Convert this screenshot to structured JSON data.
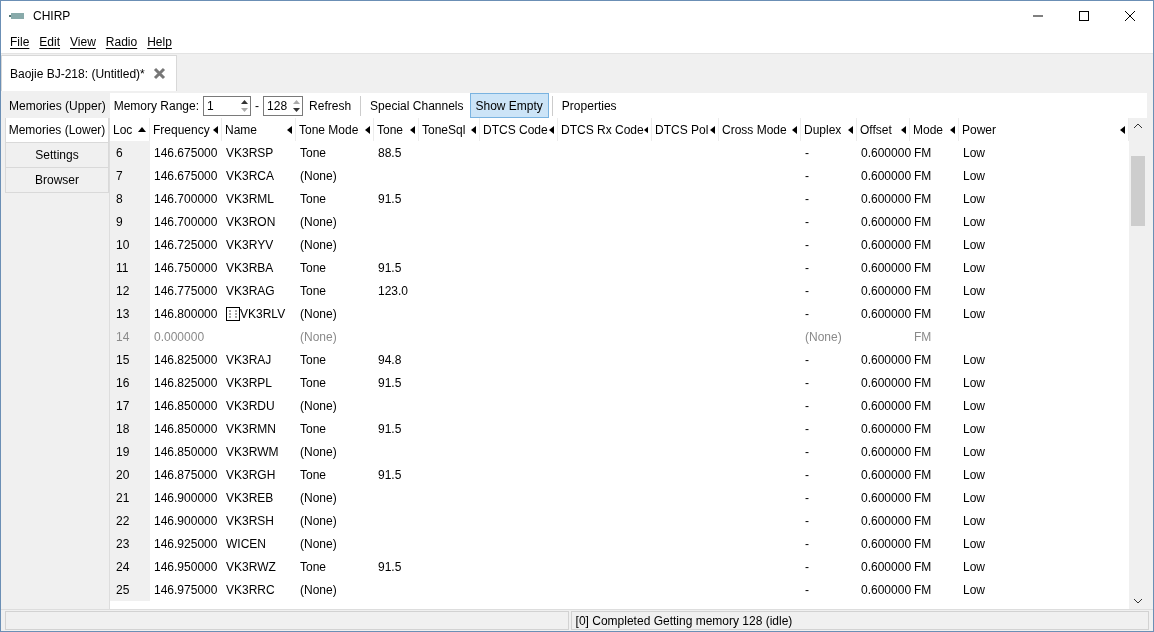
{
  "window": {
    "title": "CHIRP"
  },
  "menu": [
    "File",
    "Edit",
    "View",
    "Radio",
    "Help"
  ],
  "document_tab": {
    "label": "Baojie BJ-218: (Untitled)*",
    "selected": true
  },
  "toolbar": {
    "upper_tab": {
      "label": "Memories (Upper)",
      "selected": false
    },
    "range_label": "Memory Range:",
    "range_from": "1",
    "range_sep": "-",
    "range_to": "128",
    "refresh": "Refresh",
    "special": {
      "label": "Special Channels",
      "selected": false
    },
    "show_empty": {
      "label": "Show Empty",
      "selected": true
    },
    "properties": "Properties"
  },
  "side_tabs": [
    {
      "label": "Memories (Lower)",
      "selected": true
    },
    {
      "label": "Settings",
      "selected": false
    },
    {
      "label": "Browser",
      "selected": false
    }
  ],
  "table": {
    "columns": [
      {
        "label": "Loc",
        "sorted": true
      },
      {
        "label": "Frequency",
        "sorted": false
      },
      {
        "label": "Name",
        "sorted": false
      },
      {
        "label": "Tone Mode",
        "sorted": false
      },
      {
        "label": "Tone",
        "sorted": false
      },
      {
        "label": "ToneSql",
        "sorted": false
      },
      {
        "label": "DTCS Code",
        "sorted": false
      },
      {
        "label": "DTCS Rx Code",
        "sorted": false
      },
      {
        "label": "DTCS Pol",
        "sorted": false
      },
      {
        "label": "Cross Mode",
        "sorted": false
      },
      {
        "label": "Duplex",
        "sorted": false
      },
      {
        "label": "Offset",
        "sorted": false
      },
      {
        "label": "Mode",
        "sorted": false
      },
      {
        "label": "Power",
        "sorted": false
      }
    ],
    "rows": [
      {
        "empty": false,
        "glyph": false,
        "cells": [
          "6",
          "146.675000",
          "VK3RSP",
          "Tone",
          "88.5",
          "",
          "",
          "",
          "",
          "",
          "-",
          "0.600000",
          "FM",
          "Low"
        ]
      },
      {
        "empty": false,
        "glyph": false,
        "cells": [
          "7",
          "146.675000",
          "VK3RCA",
          "(None)",
          "",
          "",
          "",
          "",
          "",
          "",
          "-",
          "0.600000",
          "FM",
          "Low"
        ]
      },
      {
        "empty": false,
        "glyph": false,
        "cells": [
          "8",
          "146.700000",
          "VK3RML",
          "Tone",
          "91.5",
          "",
          "",
          "",
          "",
          "",
          "-",
          "0.600000",
          "FM",
          "Low"
        ]
      },
      {
        "empty": false,
        "glyph": false,
        "cells": [
          "9",
          "146.700000",
          "VK3RON",
          "(None)",
          "",
          "",
          "",
          "",
          "",
          "",
          "-",
          "0.600000",
          "FM",
          "Low"
        ]
      },
      {
        "empty": false,
        "glyph": false,
        "cells": [
          "10",
          "146.725000",
          "VK3RYV",
          "(None)",
          "",
          "",
          "",
          "",
          "",
          "",
          "-",
          "0.600000",
          "FM",
          "Low"
        ]
      },
      {
        "empty": false,
        "glyph": false,
        "cells": [
          "11",
          "146.750000",
          "VK3RBA",
          "Tone",
          "91.5",
          "",
          "",
          "",
          "",
          "",
          "-",
          "0.600000",
          "FM",
          "Low"
        ]
      },
      {
        "empty": false,
        "glyph": false,
        "cells": [
          "12",
          "146.775000",
          "VK3RAG",
          "Tone",
          "123.0",
          "",
          "",
          "",
          "",
          "",
          "-",
          "0.600000",
          "FM",
          "Low"
        ]
      },
      {
        "empty": false,
        "glyph": true,
        "cells": [
          "13",
          "146.800000",
          "VK3RLV",
          "(None)",
          "",
          "",
          "",
          "",
          "",
          "",
          "-",
          "0.600000",
          "FM",
          "Low"
        ]
      },
      {
        "empty": true,
        "glyph": false,
        "cells": [
          "14",
          "0.000000",
          "",
          "(None)",
          "",
          "",
          "",
          "",
          "",
          "",
          "(None)",
          "",
          "FM",
          ""
        ]
      },
      {
        "empty": false,
        "glyph": false,
        "cells": [
          "15",
          "146.825000",
          "VK3RAJ",
          "Tone",
          "94.8",
          "",
          "",
          "",
          "",
          "",
          "-",
          "0.600000",
          "FM",
          "Low"
        ]
      },
      {
        "empty": false,
        "glyph": false,
        "cells": [
          "16",
          "146.825000",
          "VK3RPL",
          "Tone",
          "91.5",
          "",
          "",
          "",
          "",
          "",
          "-",
          "0.600000",
          "FM",
          "Low"
        ]
      },
      {
        "empty": false,
        "glyph": false,
        "cells": [
          "17",
          "146.850000",
          "VK3RDU",
          "(None)",
          "",
          "",
          "",
          "",
          "",
          "",
          "-",
          "0.600000",
          "FM",
          "Low"
        ]
      },
      {
        "empty": false,
        "glyph": false,
        "cells": [
          "18",
          "146.850000",
          "VK3RMN",
          "Tone",
          "91.5",
          "",
          "",
          "",
          "",
          "",
          "-",
          "0.600000",
          "FM",
          "Low"
        ]
      },
      {
        "empty": false,
        "glyph": false,
        "cells": [
          "19",
          "146.850000",
          "VK3RWM",
          "(None)",
          "",
          "",
          "",
          "",
          "",
          "",
          "-",
          "0.600000",
          "FM",
          "Low"
        ]
      },
      {
        "empty": false,
        "glyph": false,
        "cells": [
          "20",
          "146.875000",
          "VK3RGH",
          "Tone",
          "91.5",
          "",
          "",
          "",
          "",
          "",
          "-",
          "0.600000",
          "FM",
          "Low"
        ]
      },
      {
        "empty": false,
        "glyph": false,
        "cells": [
          "21",
          "146.900000",
          "VK3REB",
          "(None)",
          "",
          "",
          "",
          "",
          "",
          "",
          "-",
          "0.600000",
          "FM",
          "Low"
        ]
      },
      {
        "empty": false,
        "glyph": false,
        "cells": [
          "22",
          "146.900000",
          "VK3RSH",
          "(None)",
          "",
          "",
          "",
          "",
          "",
          "",
          "-",
          "0.600000",
          "FM",
          "Low"
        ]
      },
      {
        "empty": false,
        "glyph": false,
        "cells": [
          "23",
          "146.925000",
          "WICEN",
          "(None)",
          "",
          "",
          "",
          "",
          "",
          "",
          "-",
          "0.600000",
          "FM",
          "Low"
        ]
      },
      {
        "empty": false,
        "glyph": false,
        "cells": [
          "24",
          "146.950000",
          "VK3RWZ",
          "Tone",
          "91.5",
          "",
          "",
          "",
          "",
          "",
          "-",
          "0.600000",
          "FM",
          "Low"
        ]
      },
      {
        "empty": false,
        "glyph": false,
        "cells": [
          "25",
          "146.975000",
          "VK3RRC",
          "(None)",
          "",
          "",
          "",
          "",
          "",
          "",
          "-",
          "0.600000",
          "FM",
          "Low"
        ]
      }
    ]
  },
  "status_bar": {
    "message": "[0] Completed Getting memory 128 (idle)"
  }
}
